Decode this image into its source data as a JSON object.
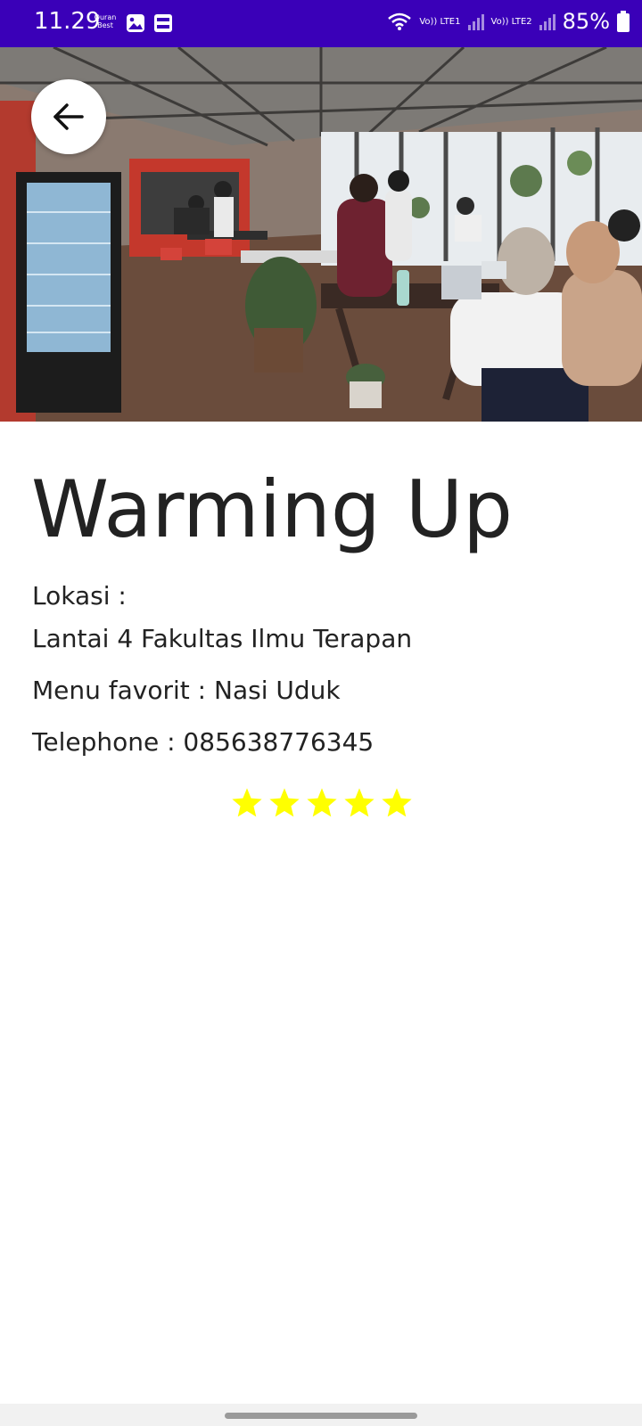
{
  "status_bar": {
    "time": "11.29",
    "app_badge": "Quran Best",
    "sim1_label": "Vo)) LTE1",
    "sim2_label": "Vo)) LTE2",
    "battery": "85%"
  },
  "detail": {
    "title": "Warming Up",
    "location_label": "Lokasi :",
    "location_value": "Lantai 4 Fakultas Ilmu Terapan",
    "favorite_menu": "Menu favorit : Nasi Uduk",
    "telephone": "Telephone : 085638776345",
    "rating": 5,
    "rating_max": 5,
    "star_color": "#ffff00"
  },
  "colors": {
    "status_bar": "#3a00b8",
    "background": "#ffffff",
    "text": "#222222"
  }
}
